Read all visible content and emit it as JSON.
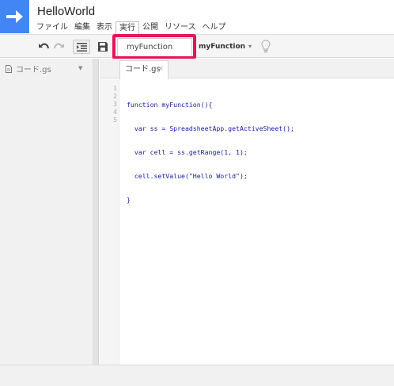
{
  "app": {
    "title": "HelloWorld"
  },
  "menu": [
    {
      "label": "ファイル"
    },
    {
      "label": "編集"
    },
    {
      "label": "表示"
    },
    {
      "label": "実行",
      "active": true
    },
    {
      "label": "公開"
    },
    {
      "label": "リソース"
    },
    {
      "label": "ヘルプ"
    }
  ],
  "toolbar": {
    "function_select_value": "myFunction",
    "run_function_label": "myFunction"
  },
  "sidebar": {
    "file_label": "コード.gs"
  },
  "editor": {
    "tab_label": "コード.gs",
    "line_numbers": [
      "1",
      "2",
      "3",
      "4",
      "5"
    ],
    "lines": [
      "function myFunction(){",
      "  var ss = SpreadsheetApp.getActiveSheet();",
      "  var cell = ss.getRange(1, 1);",
      "  cell.setValue(\"Hello World\");",
      "}"
    ]
  },
  "colors": {
    "logo": "#4285f4",
    "highlight": "#e5135b",
    "code": "#1a1aa6"
  }
}
